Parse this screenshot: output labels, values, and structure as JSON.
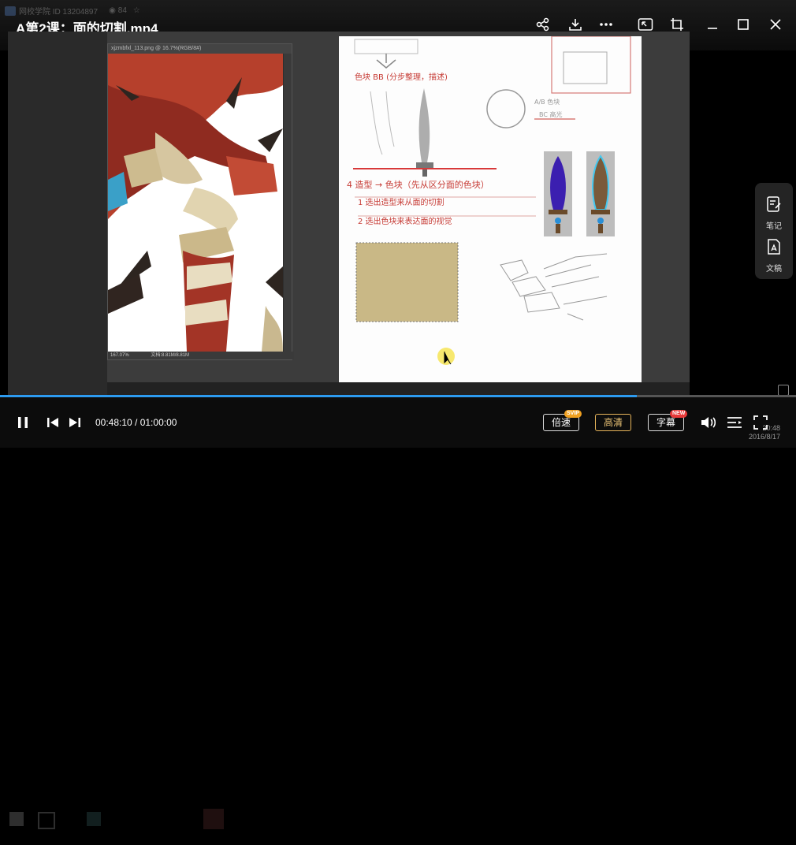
{
  "window": {
    "title": "A第2课：面的切割.mp4",
    "ghost_header": "网校学院 ID 13204897",
    "ghost_count": "84"
  },
  "colors": {
    "accent_progress": "#2d9bf0",
    "hd_gold": "#e6b45a",
    "svip_orange": "#f0a020",
    "new_red": "#e83a3a",
    "sketch_red": "#c63a34"
  },
  "top_icons": [
    "share-icon",
    "download-icon",
    "more-icon",
    "picture-in-picture-icon",
    "crop-icon",
    "minimize-icon",
    "maximize-icon",
    "close-icon"
  ],
  "video": {
    "ps_window_title": "xjzmbfxl_113.png @ 16.7%(RGB/8#)",
    "ps_status_zoom": "167.07%",
    "ps_status_doc": "文档:8.81M/8.81M",
    "doc_notes": {
      "note_a": "色块 BB (分步整理，描述)",
      "note_b": "A/B 色块",
      "note_c": "BC 高光",
      "note_d": "4 造型 → 色块（先从区分面的色块）",
      "note_e": "1 选出造型来从面的切割",
      "note_f": "2 选出色块来表达面的视觉"
    }
  },
  "side_panel": {
    "notes_label": "笔记",
    "transcript_label": "文稿"
  },
  "player": {
    "progress_fraction": 0.8,
    "time_display": "00:48:10 / 01:00:00",
    "speed_label": "倍速",
    "speed_badge": "SVIP",
    "quality_label": "高清",
    "subtitle_label": "字幕",
    "subtitle_badge": "NEW"
  },
  "taskbar": {
    "clock": "20:48",
    "date": "2016/8/17"
  }
}
